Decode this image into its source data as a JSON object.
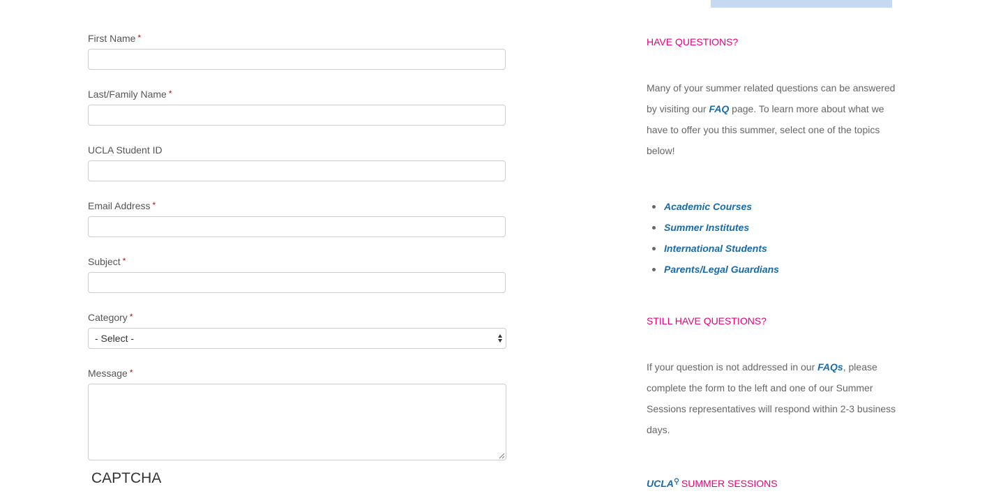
{
  "form": {
    "fields": [
      {
        "label": "First Name",
        "required_mark": "*"
      },
      {
        "label": "Last/Family Name",
        "required_mark": "*"
      },
      {
        "label": "UCLA Student ID",
        "required_mark": ""
      },
      {
        "label": "Email Address",
        "required_mark": "*"
      },
      {
        "label": "Subject",
        "required_mark": "*"
      }
    ],
    "category": {
      "label": "Category",
      "required_mark": "*",
      "selected": "- Select -"
    },
    "message": {
      "label": "Message",
      "required_mark": "*"
    },
    "captcha": "CAPTCHA"
  },
  "sidebar": {
    "heading1": "HAVE QUESTIONS?",
    "intro": {
      "part1": "Many of your summer related questions can be answered by visiting our ",
      "faq_link": "FAQ",
      "part2": " page. To learn more about what we have to offer you this summer, select one of the topics below!"
    },
    "topics": [
      "Academic Courses",
      "Summer Institutes",
      "International Students",
      "Parents/Legal Guardians"
    ],
    "heading2": "STILL HAVE QUESTIONS?",
    "outro": {
      "part1": "If your question is not addressed in our ",
      "faqs_link": "FAQs",
      "part2": ", please complete the form to the left and one of our Summer Sessions representatives will respond within 2-3 business days."
    },
    "brand": {
      "ucla": "UCLA",
      "name": "SUMMER SESSIONS"
    }
  },
  "colors": {
    "accent_pink": "#e6007e",
    "link_blue": "#1a6aa8",
    "required_red": "#cc0000",
    "top_block": "#c5d9f1"
  },
  "icons": {
    "select_arrows": "select-arrows-icon",
    "resize": "resize-handle-icon",
    "brand_pin": "map-pin-icon"
  }
}
